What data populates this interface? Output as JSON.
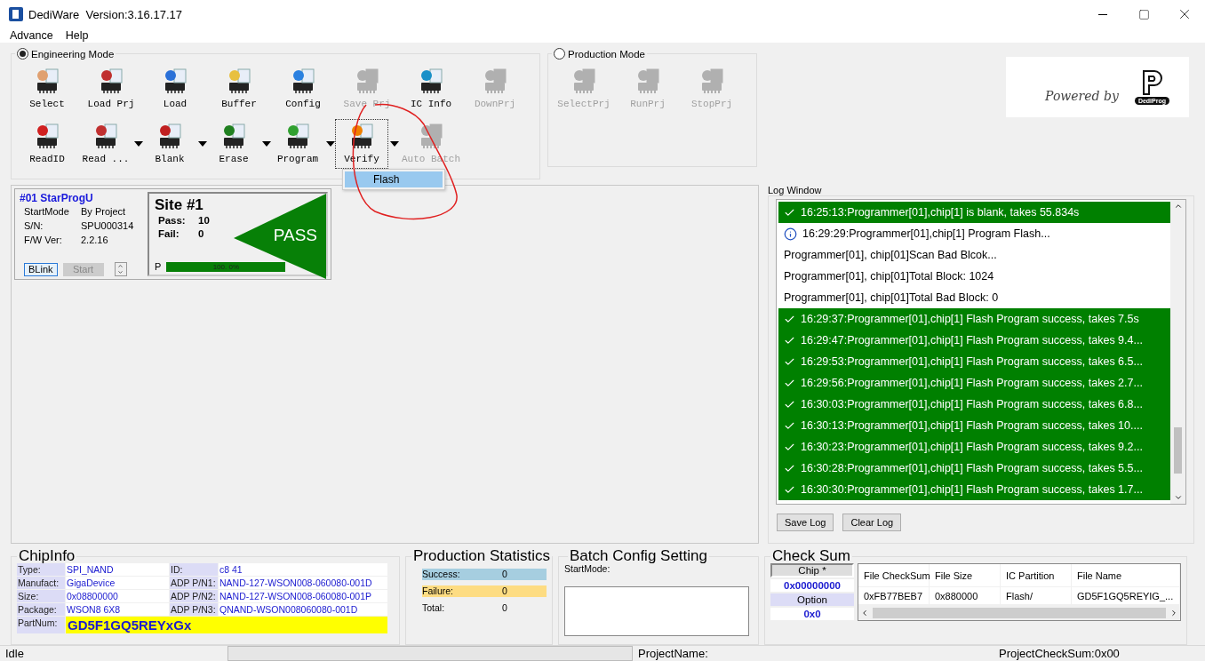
{
  "window": {
    "title": "DediWare  Version:3.16.17.17"
  },
  "menu": [
    {
      "label": "Advance"
    },
    {
      "label": "Help"
    }
  ],
  "engineering_mode": {
    "label": "Engineering Mode",
    "selected": true,
    "rows": [
      [
        {
          "label": "Select",
          "disabled": false
        },
        {
          "label": "Load Prj",
          "disabled": false
        },
        {
          "label": "Load",
          "disabled": false
        },
        {
          "label": "Buffer",
          "disabled": false
        },
        {
          "label": "Config",
          "disabled": false
        },
        {
          "label": "Save Prj",
          "disabled": true
        },
        {
          "label": "IC Info",
          "disabled": false
        },
        {
          "label": "DownPrj",
          "disabled": true
        }
      ],
      [
        {
          "label": "ReadID",
          "disabled": false,
          "dropdown": false
        },
        {
          "label": "Read ...",
          "disabled": false,
          "dropdown": true
        },
        {
          "label": "Blank",
          "disabled": false,
          "dropdown": true
        },
        {
          "label": "Erase",
          "disabled": false,
          "dropdown": true
        },
        {
          "label": "Program",
          "disabled": false,
          "dropdown": true
        },
        {
          "label": "Verify",
          "disabled": false,
          "dropdown": true,
          "focused": true
        },
        {
          "label": "Auto Batch",
          "disabled": true,
          "dropdown": false
        }
      ]
    ]
  },
  "dropdown_menu": {
    "items": [
      {
        "label": "Flash",
        "selected": true
      }
    ]
  },
  "production_mode": {
    "label": "Production Mode",
    "selected": false,
    "buttons": [
      {
        "label": "SelectPrj",
        "disabled": true
      },
      {
        "label": "RunPrj",
        "disabled": true
      },
      {
        "label": "StopPrj",
        "disabled": true
      }
    ]
  },
  "logo": {
    "tagline": "Powered by",
    "brand": "DediProg"
  },
  "site": {
    "title": "#01 StarProgU",
    "fields": [
      {
        "label": "StartMode",
        "value": "By Project"
      },
      {
        "label": "S/N:",
        "value": "SPU000314"
      },
      {
        "label": "F/W Ver:",
        "value": "2.2.16"
      }
    ],
    "buttons": [
      {
        "label": "BLink",
        "disabled": false
      },
      {
        "label": "Start",
        "disabled": true
      }
    ],
    "status": {
      "title": "Site #1",
      "counts": [
        {
          "label": "Pass:",
          "value": "10"
        },
        {
          "label": "Fail:",
          "value": "0"
        }
      ],
      "result": "PASS",
      "progress_label": "P",
      "level": 1,
      "reading": "100. 0%"
    }
  },
  "log_window": {
    "title": "Log Window",
    "rows": [
      {
        "kind": "success",
        "text": "16:25:13:Programmer[01],chip[1] is blank, takes 55.834s"
      },
      {
        "kind": "info",
        "text": "16:29:29:Programmer[01],chip[1] Program Flash..."
      },
      {
        "kind": "plain",
        "text": "Programmer[01], chip[01]Scan Bad Blcok..."
      },
      {
        "kind": "plain",
        "text": "Programmer[01], chip[01]Total Block: 1024"
      },
      {
        "kind": "plain",
        "text": "Programmer[01], chip[01]Total Bad Block: 0"
      },
      {
        "kind": "success",
        "text": "16:29:37:Programmer[01],chip[1] Flash Program success, takes 7.5s"
      },
      {
        "kind": "success",
        "text": "16:29:47:Programmer[01],chip[1] Flash Program success, takes 9.4..."
      },
      {
        "kind": "success",
        "text": "16:29:53:Programmer[01],chip[1] Flash Program success, takes 6.5..."
      },
      {
        "kind": "success",
        "text": "16:29:56:Programmer[01],chip[1] Flash Program success, takes 2.7..."
      },
      {
        "kind": "success",
        "text": "16:30:03:Programmer[01],chip[1] Flash Program success, takes 6.8..."
      },
      {
        "kind": "success",
        "text": "16:30:13:Programmer[01],chip[1] Flash Program success, takes 10...."
      },
      {
        "kind": "success",
        "text": "16:30:23:Programmer[01],chip[1] Flash Program success, takes 9.2..."
      },
      {
        "kind": "success",
        "text": "16:30:28:Programmer[01],chip[1] Flash Program success, takes 5.5..."
      },
      {
        "kind": "success",
        "text": "16:30:30:Programmer[01],chip[1] Flash Program success, takes 1.7..."
      }
    ],
    "buttons": [
      {
        "label": "Save Log"
      },
      {
        "label": "Clear Log"
      }
    ]
  },
  "chip_info": {
    "title": "ChipInfo",
    "rows": [
      [
        "Type:",
        "SPI_NAND",
        "ID:",
        "c8 41"
      ],
      [
        "Manufact:",
        "GigaDevice",
        "ADP P/N1:",
        "NAND-127-WSON008-060080-001D"
      ],
      [
        "Size:",
        "0x08800000",
        "ADP P/N2:",
        "NAND-127-WSON008-060080-001P"
      ],
      [
        "Package:",
        "WSON8 6X8",
        "ADP P/N3:",
        "QNAND-WSON008060080-001D"
      ]
    ],
    "part_number": {
      "label": "PartNum:",
      "value": "GD5F1GQ5REYxGx"
    }
  },
  "production_statistics": {
    "title": "Production Statistics",
    "rows": [
      {
        "label": "Success:",
        "value": "0",
        "color": "#a6cee0"
      },
      {
        "label": "Failure:",
        "value": "0",
        "color": "#fddc82"
      },
      {
        "label": "Total:",
        "value": "0"
      }
    ]
  },
  "batch_config": {
    "title": "Batch Config Setting",
    "label": "StartMode:"
  },
  "check_sum": {
    "title": "Check Sum",
    "chip_label": "Chip *",
    "chip_value": "0x00000000",
    "option_label": "Option",
    "option_value": "0x0",
    "columns": [
      "File CheckSum",
      "File Size",
      "IC Partition",
      "File Name"
    ],
    "rows": [
      [
        "0xFB77BEB7",
        "0x880000",
        "Flash/",
        "GD5F1GQ5REYIG_..."
      ]
    ]
  },
  "status_bar": {
    "state": "Idle",
    "project_name": "ProjectName:",
    "project_checksum": "ProjectCheckSum:0x00"
  }
}
